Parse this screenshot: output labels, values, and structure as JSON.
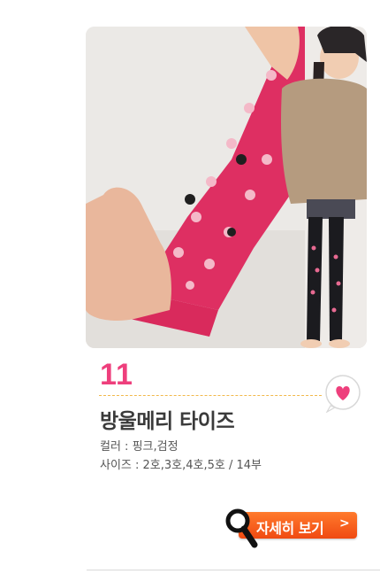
{
  "product": {
    "number": "11",
    "name": "방울메리 타이즈",
    "color_line": "컬러 : 핑크,검정",
    "size_line": "사이즈 : 2호,3호,4호,5호 / 14부"
  },
  "detail_button": {
    "label": "자세히 보기",
    "arrow": ">"
  },
  "colors": {
    "accent_pink": "#ee3f7c",
    "button_orange": "#f04a12",
    "dash_gold": "#f2b84a"
  },
  "icons": [
    "heart-bubble-icon",
    "magnifier-icon",
    "chevron-right-icon"
  ]
}
